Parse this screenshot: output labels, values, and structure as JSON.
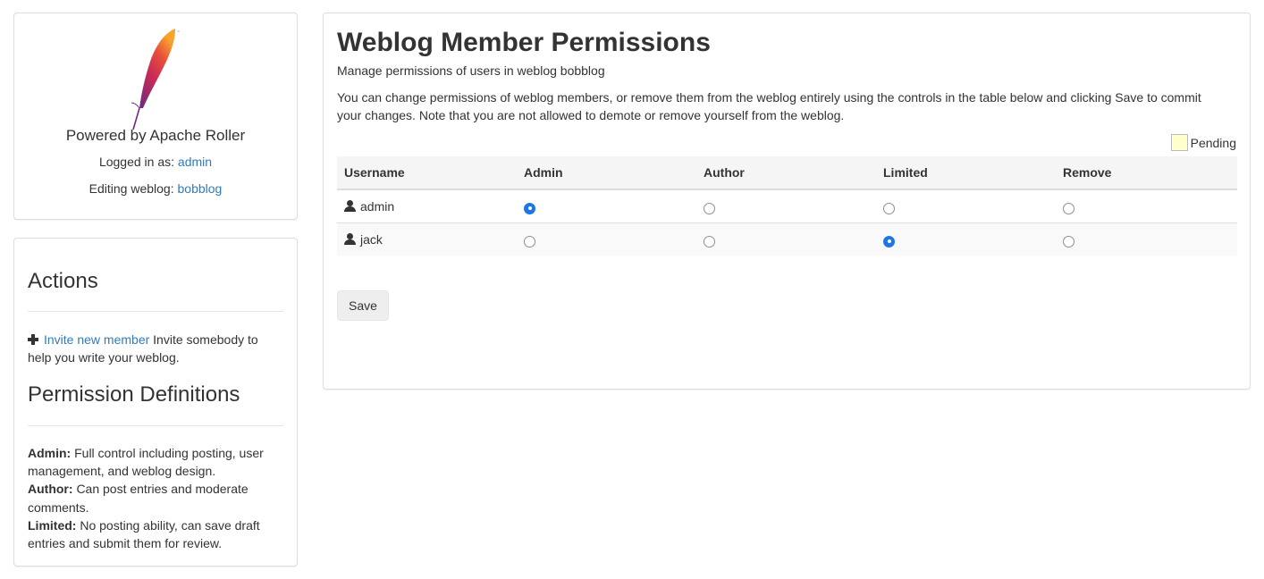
{
  "sidebar": {
    "powered_by": "Powered by Apache Roller",
    "logged_in_label": "Logged in as:",
    "logged_in_user": "admin",
    "editing_label": "Editing weblog:",
    "editing_weblog": "bobblog",
    "actions_heading": "Actions",
    "invite_link": "Invite new member",
    "invite_text": "Invite somebody to help you write your weblog.",
    "definitions_heading": "Permission Definitions",
    "definitions": [
      {
        "term": "Admin:",
        "text": "Full control including posting, user management, and weblog design."
      },
      {
        "term": "Author:",
        "text": "Can post entries and moderate comments."
      },
      {
        "term": "Limited:",
        "text": "No posting ability, can save draft entries and submit them for review."
      }
    ]
  },
  "main": {
    "title": "Weblog Member Permissions",
    "subtitle": "Manage permissions of users in weblog bobblog",
    "description": "You can change permissions of weblog members, or remove them from the weblog entirely using the controls in the table below and clicking Save to commit your changes. Note that you are not allowed to demote or remove yourself from the weblog.",
    "legend_pending": "Pending",
    "table": {
      "headers": [
        "Username",
        "Admin",
        "Author",
        "Limited",
        "Remove"
      ],
      "rows": [
        {
          "username": "admin",
          "selected": "Admin"
        },
        {
          "username": "jack",
          "selected": "Limited"
        }
      ]
    },
    "save_label": "Save"
  },
  "colors": {
    "link": "#337ab7",
    "pending_swatch": "#ffffcc",
    "radio_selected": "#1e76e6"
  }
}
